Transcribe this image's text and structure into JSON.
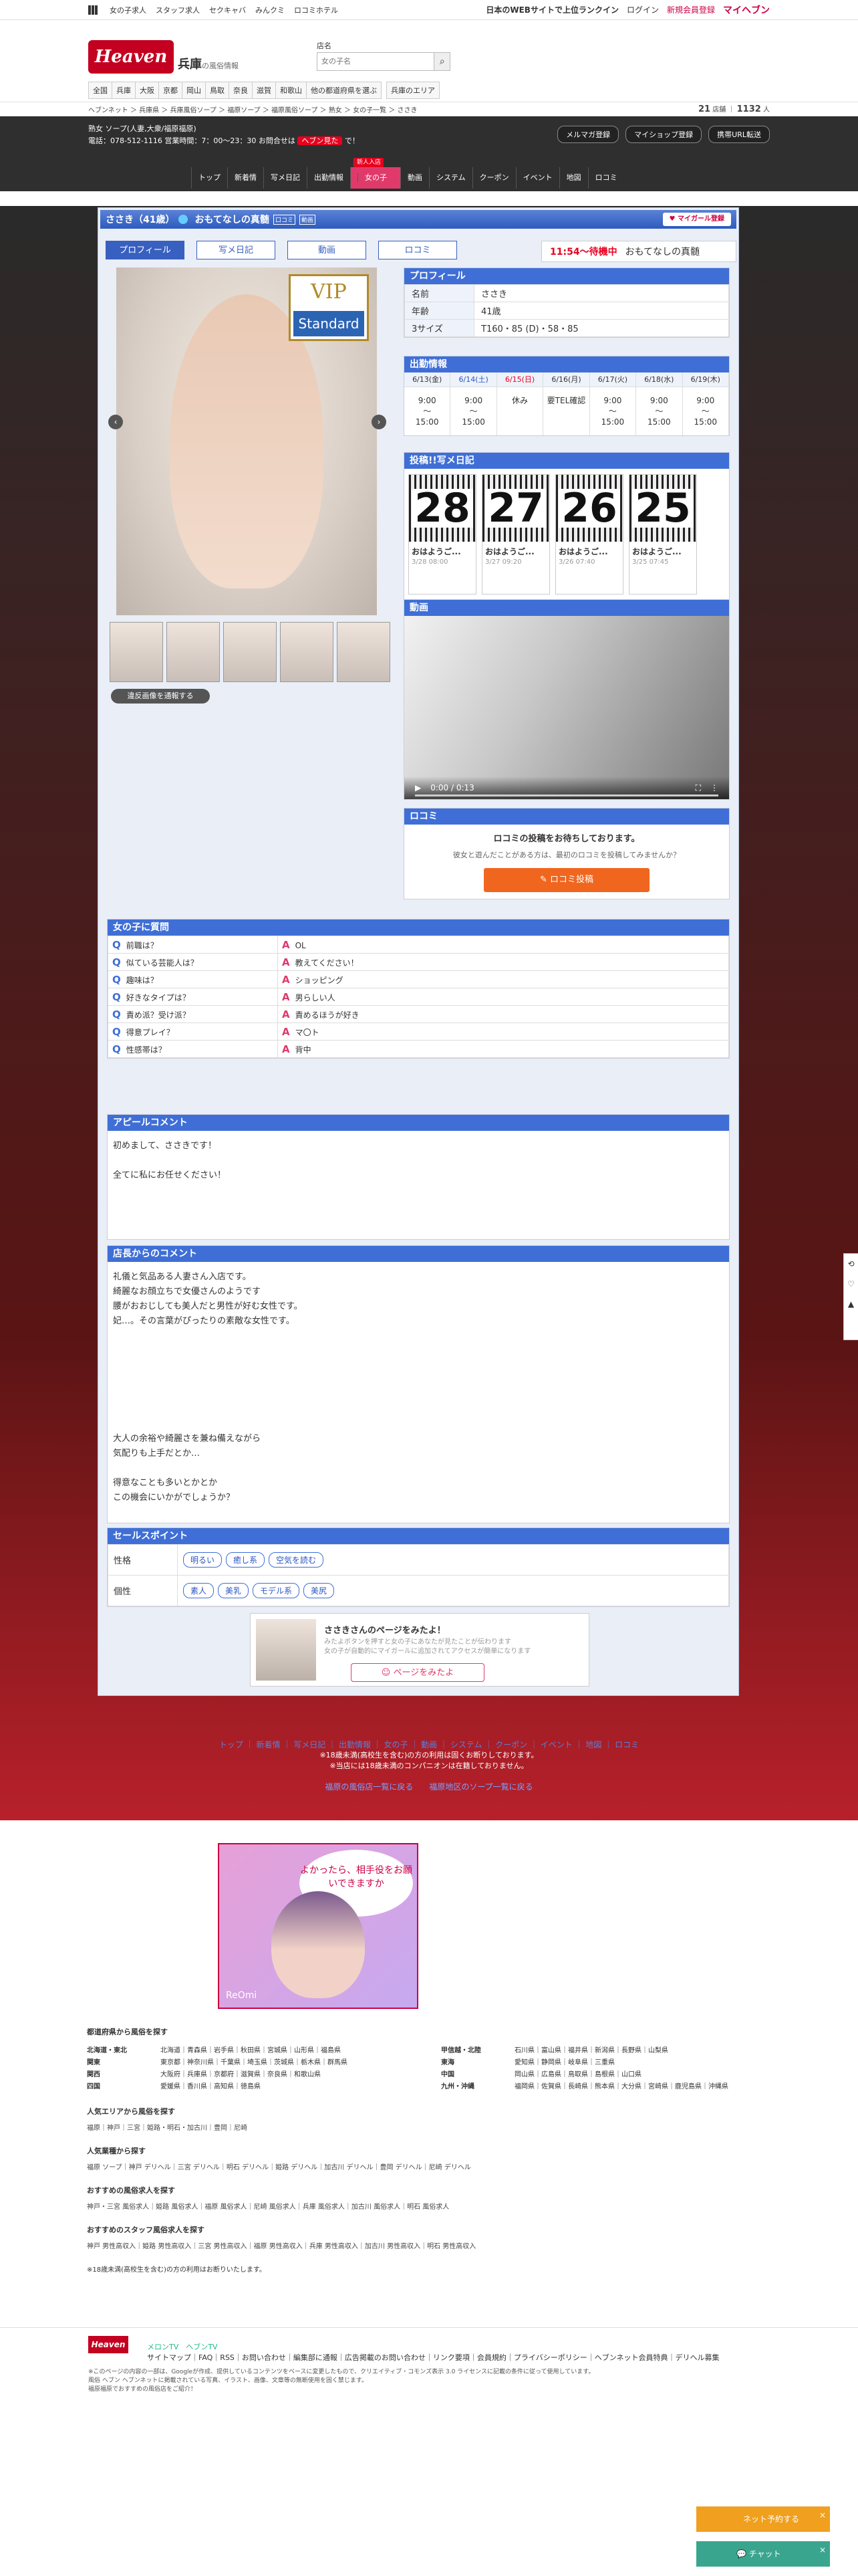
{
  "topbar": {
    "links": [
      "女の子求人",
      "スタッフ求人",
      "セクキャバ",
      "みんクミ",
      "ロコミホテル"
    ],
    "right_text": "日本のWEBサイトで上位ランクイン",
    "login": "ログイン",
    "register": "新規会員登録",
    "myheaven": "マイヘブン"
  },
  "header": {
    "logo": "Heaven",
    "region": "兵庫",
    "region_sub": "の風俗情報",
    "search_label": "店名",
    "search_placeholder": "女の子名",
    "nav": [
      "全国",
      "兵庫",
      "大阪",
      "京都",
      "岡山",
      "鳥取",
      "奈良",
      "滋賀",
      "和歌山",
      "他の都道府県を選ぶ",
      "兵庫のエリア"
    ]
  },
  "breadcrumb": "ヘブンネット ＞ 兵庫県 ＞ 兵庫風俗ソープ ＞ 福原ソープ ＞ 福原風俗ソープ ＞ 熟女 ＞ 女の子一覧 ＞ ささき",
  "counts": {
    "shops": "21",
    "shops_unit": "店舗",
    "girls": "1132",
    "girls_unit": "人"
  },
  "shop": {
    "line1": "熟女 ソープ(人妻,大衆/福原福原)",
    "line2": "電話：078-512-1116 営業時間：7：00〜23：30 お問合せは",
    "tel_badge": "ヘブン見た",
    "line2_end": "で！",
    "buttons": [
      "メルマガ登録",
      "マイショップ登録",
      "携帯URL転送"
    ],
    "nav": [
      "トップ",
      "新着情",
      "写メ日記",
      "出勤情報",
      "女の子",
      "動画",
      "システム",
      "クーポン",
      "イベント",
      "地図",
      "ロコミ"
    ],
    "new_badge": "新人入店"
  },
  "profile_title": {
    "name": "ささき（41歳）",
    "catch": "おもてなしの真髄",
    "tags": [
      "口コミ",
      "動画"
    ],
    "mygirl": "マイガール登録"
  },
  "tabs": [
    "プロフィール",
    "写メ日記",
    "動画",
    "ロコミ"
  ],
  "wait": {
    "time": "11:54〜待機中",
    "scroll": "おもてなしの真髄"
  },
  "vip": {
    "top": "VIP",
    "bottom": "Standard"
  },
  "violation": "違反画像を通報する",
  "profile": {
    "heading": "プロフィール",
    "rows": [
      {
        "k": "名前",
        "v": "ささき"
      },
      {
        "k": "年齢",
        "v": "41歳"
      },
      {
        "k": "3サイズ",
        "v": "T160・85 (D)・58・85"
      }
    ]
  },
  "schedule": {
    "heading": "出勤情報",
    "days": [
      {
        "d": "6/13(金)",
        "v": "9:00\n〜\n15:00",
        "cls": ""
      },
      {
        "d": "6/14(土)",
        "v": "9:00\n〜\n15:00",
        "cls": "sat"
      },
      {
        "d": "6/15(日)",
        "v": "休み",
        "cls": "sun"
      },
      {
        "d": "6/16(月)",
        "v": "要TEL確認",
        "cls": ""
      },
      {
        "d": "6/17(火)",
        "v": "9:00\n〜\n15:00",
        "cls": ""
      },
      {
        "d": "6/18(水)",
        "v": "9:00\n〜\n15:00",
        "cls": ""
      },
      {
        "d": "6/19(木)",
        "v": "9:00\n〜\n15:00",
        "cls": ""
      }
    ]
  },
  "diary": {
    "heading": "投稿!!写メ日記",
    "cards": [
      {
        "num": "28",
        "title": "おはようご...",
        "date": "3/28 08:00"
      },
      {
        "num": "27",
        "title": "おはようご...",
        "date": "3/27 09:20"
      },
      {
        "num": "26",
        "title": "おはようご...",
        "date": "3/26 07:40"
      },
      {
        "num": "25",
        "title": "おはようご...",
        "date": "3/25 07:45"
      }
    ]
  },
  "video": {
    "heading": "動画",
    "time": "0:00 / 0:13"
  },
  "review": {
    "heading": "ロコミ",
    "main": "ロコミの投稿をお待ちしております。",
    "sub": "彼女と遊んだことがある方は、最初のロコミを投稿してみませんか？",
    "button": "ロコミ投稿"
  },
  "qa": {
    "heading": "女の子に質問",
    "rows": [
      {
        "q": "前職は？",
        "a": "OL"
      },
      {
        "q": "似ている芸能人は？",
        "a": "教えてください！"
      },
      {
        "q": "趣味は？",
        "a": "ショッピング"
      },
      {
        "q": "好きなタイプは？",
        "a": "男らしい人"
      },
      {
        "q": "責め派？受け派？",
        "a": "責めるほうが好き"
      },
      {
        "q": "得意プレイ？",
        "a": "マ〇ト"
      },
      {
        "q": "性感帯は？",
        "a": "背中"
      }
    ]
  },
  "appeal": {
    "heading": "アピールコメント",
    "text": "初めまして、ささきです！\n\n全てに私にお任せください！"
  },
  "shopcomment": {
    "heading": "店長からのコメント",
    "text": "礼儀と気品ある人妻さん入店です。\n綺麗なお顔立ちで女優さんのようです\n腰がおおじしても美人だと男性が好む女性です。\n妃…。その言葉がぴったりの素敵な女性です。\n\n\n\n\n\n\n\n大人の余裕や綺麗さを兼ね備えながら\n気配りも上手だとか…\n\n得意なことも多いとかとか\nこの機会にいかがでしょうか？"
  },
  "salespoint": {
    "heading": "セールスポイント",
    "rows": [
      {
        "k": "性格",
        "chips": [
          "明るい",
          "癒し系",
          "空気を読む"
        ]
      },
      {
        "k": "個性",
        "chips": [
          "素人",
          "美乳",
          "モデル系",
          "美尻"
        ]
      }
    ]
  },
  "mybanner": {
    "title": "ささきさんのページをみたよ！",
    "desc": "みたよボタンを押すと女の子にあなたが見たことが伝わります\n女の子が自動的にマイガールに追加されてアクセスが簡単になります",
    "button": "ページをみたよ"
  },
  "footnav": {
    "links": [
      "トップ",
      "新着情",
      "写メ日記",
      "出勤情報",
      "女の子",
      "動画",
      "システム",
      "クーポン",
      "イベント",
      "地図",
      "ロコミ"
    ],
    "note1": "※18歳未満(高校生を含む)の方の利用は固くお断りしております。",
    "note2": "※当店には18歳未満のコンパニオンは在籍しておりません。",
    "more1": "福原の風俗店一覧に戻る",
    "more2": "福原地区のソープ一覧に戻る"
  },
  "ad": {
    "bubble": "よかったら、相手役をお願いできますか",
    "logo": "ReOmi"
  },
  "pref": {
    "heading": "都道府県から風俗を探す",
    "rows": [
      {
        "k": "北海道・東北",
        "v": "北海道｜青森県｜岩手県｜秋田県｜宮城県｜山形県｜福島県"
      },
      {
        "k": "関東",
        "v": "東京都｜神奈川県｜千葉県｜埼玉県｜茨城県｜栃木県｜群馬県"
      },
      {
        "k": "関西",
        "v": "大阪府｜兵庫県｜京都府｜滋賀県｜奈良県｜和歌山県"
      },
      {
        "k": "四国",
        "v": "愛媛県｜香川県｜高知県｜徳島県"
      }
    ],
    "rows2": [
      {
        "k": "甲信越・北陸",
        "v": "石川県｜富山県｜福井県｜新潟県｜長野県｜山梨県"
      },
      {
        "k": "東海",
        "v": "愛知県｜静岡県｜岐阜県｜三重県"
      },
      {
        "k": "中国",
        "v": "岡山県｜広島県｜鳥取県｜島根県｜山口県"
      },
      {
        "k": "九州・沖縄",
        "v": "福岡県｜佐賀県｜長崎県｜熊本県｜大分県｜宮崎県｜鹿児島県｜沖縄県"
      }
    ],
    "groups": [
      {
        "t": "人気エリアから風俗を探す",
        "p": "福原｜神戸｜三宮｜姫路・明石・加古川｜豊岡｜尼崎"
      },
      {
        "t": "人気業種から探す",
        "p": "福原 ソープ｜神戸 デリヘル｜三宮 デリヘル｜明石 デリヘル｜姫路 デリヘル｜加古川 デリヘル｜豊岡 デリヘル｜尼崎 デリヘル"
      },
      {
        "t": "おすすめの風俗求人を探す",
        "p": "神戸・三宮 風俗求人｜姫路 風俗求人｜福原 風俗求人｜尼崎 風俗求人｜兵庫 風俗求人｜加古川 風俗求人｜明石 風俗求人"
      },
      {
        "t": "おすすめのスタッフ風俗求人を探す",
        "p": "神戸 男性高収入｜姫路 男性高収入｜三宮 男性高収入｜福原 男性高収入｜兵庫 男性高収入｜加古川 男性高収入｜明石 男性高収入"
      }
    ],
    "age": "※18歳未満(高校生を含む)の方の利用はお断りいたします。"
  },
  "footer": {
    "logo": "Heaven",
    "links": "サイトマップ｜FAQ｜RSS｜お問い合わせ｜編集部に通報｜広告掲載のお問い合わせ｜リンク要項｜会員規約｜プライバシーポリシー｜ヘブンネット会員特典｜デリヘル募集",
    "badges": "メロンTV　ヘブンTV",
    "note": "※このページの内容の一部は、Googleが作成、提供しているコンテンツをベースに変更したもので、クリエイティブ・コモンズ表示 3.0 ライセンスに記載の条件に従って使用しています。\n風俗 ヘブン ヘブンネットに掲載されている写真、イラスト、画像、文章等の無断使用を固く禁じます。\n福原福原でおすすめの風俗店をご紹介！"
  },
  "floating": {
    "netres": "ネット予約する",
    "chat": "チャット"
  }
}
